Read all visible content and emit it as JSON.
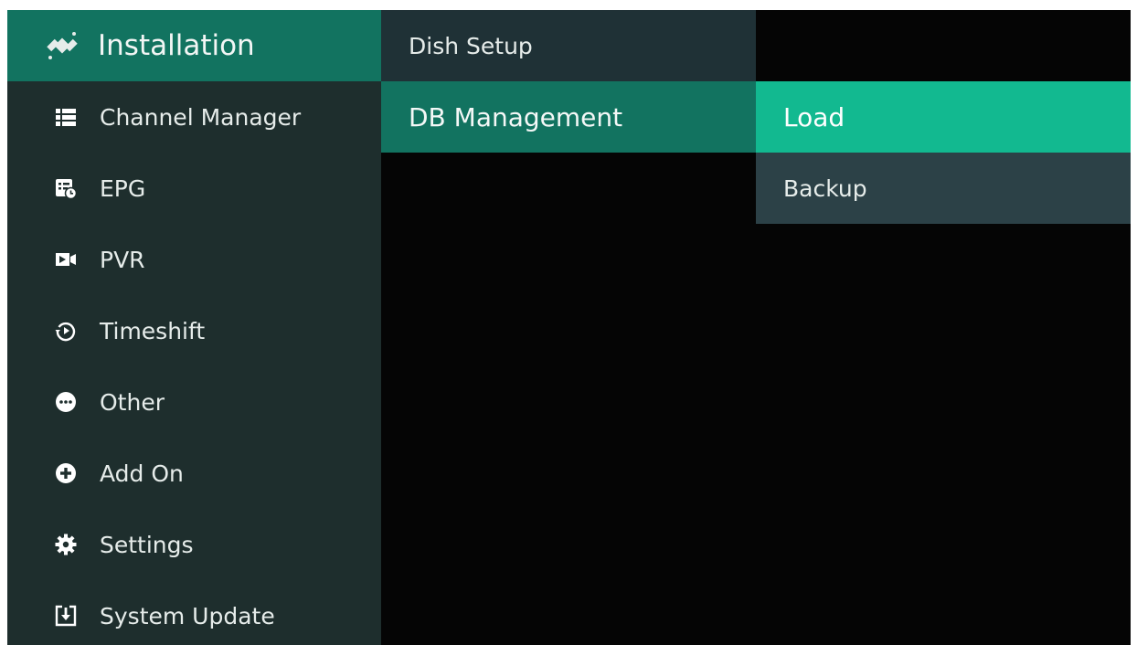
{
  "menu": {
    "header": {
      "label": "Installation",
      "icon": "satellite-icon"
    },
    "items": [
      {
        "label": "Channel Manager",
        "icon": "list-icon"
      },
      {
        "label": "EPG",
        "icon": "epg-icon"
      },
      {
        "label": "PVR",
        "icon": "video-camera-icon"
      },
      {
        "label": "Timeshift",
        "icon": "timeshift-icon"
      },
      {
        "label": "Other",
        "icon": "more-icon"
      },
      {
        "label": "Add On",
        "icon": "plus-circle-icon"
      },
      {
        "label": "Settings",
        "icon": "gear-icon"
      },
      {
        "label": "System Update",
        "icon": "download-box-icon"
      }
    ]
  },
  "submenu": {
    "items": [
      {
        "label": "Dish Setup"
      },
      {
        "label": "DB Management",
        "active": true
      }
    ]
  },
  "db_management": {
    "items": [
      {
        "label": "Load",
        "focused": true
      },
      {
        "label": "Backup"
      }
    ]
  },
  "colors": {
    "header_bg": "#127360",
    "menu_bg": "#1e2e2d",
    "focus_accent": "#12b990",
    "submenu_bg": "#1f3136",
    "submenu2_bg": "#2c4147",
    "screen_bg": "#050505"
  }
}
